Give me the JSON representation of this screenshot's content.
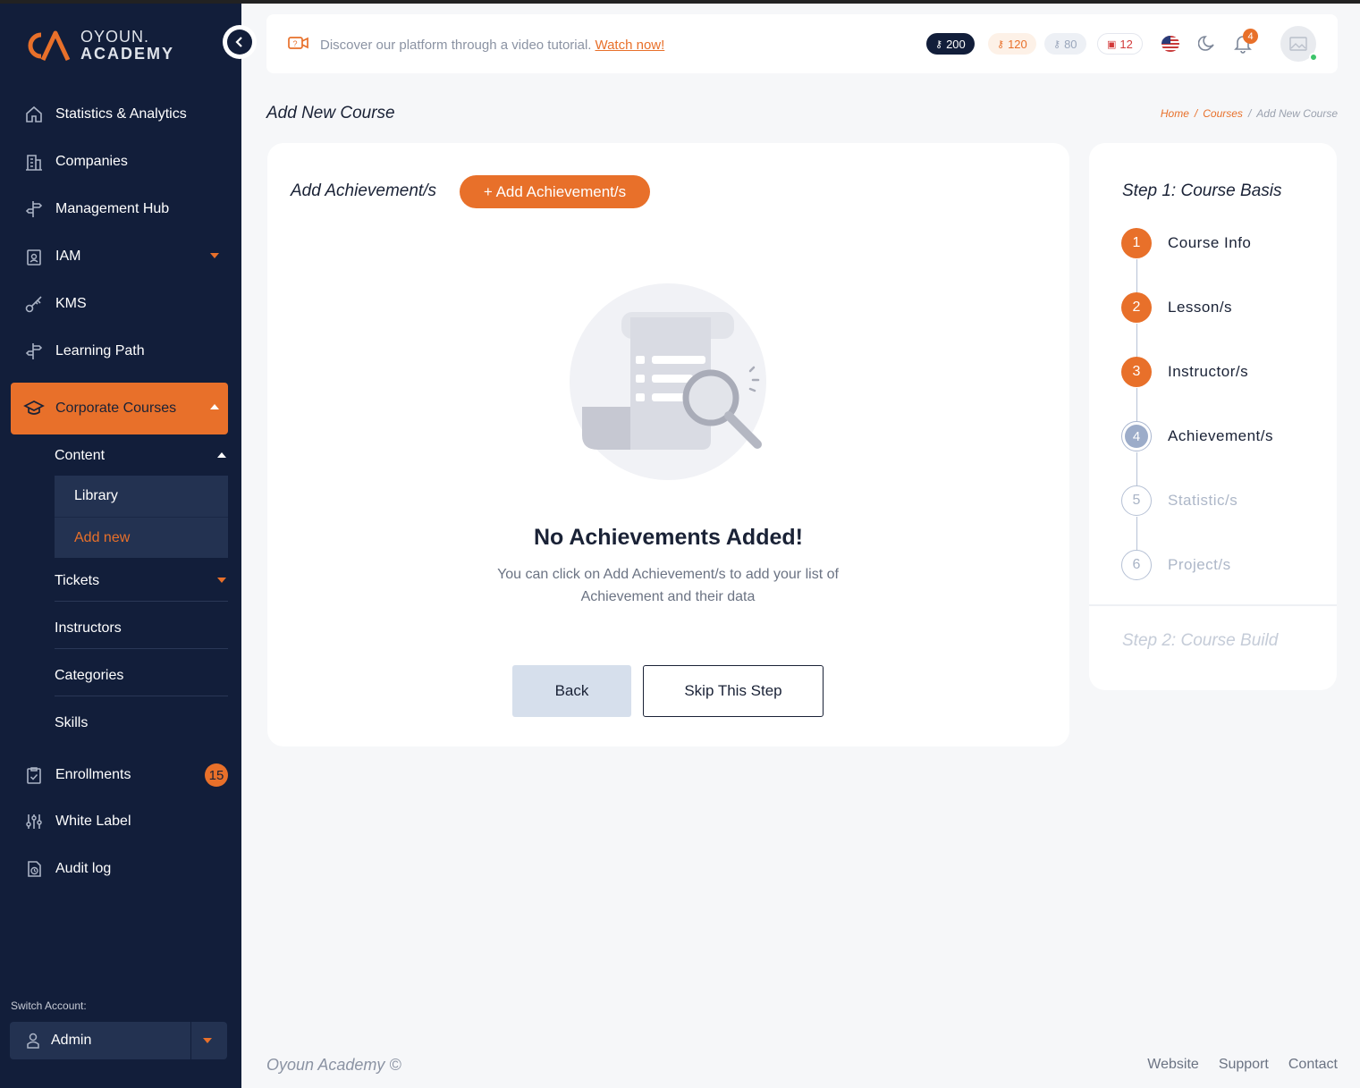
{
  "brand": {
    "line1": "OYOUN.",
    "line2": "ACADEMY"
  },
  "sidebar": {
    "items": [
      {
        "label": "Statistics & Analytics"
      },
      {
        "label": "Companies"
      },
      {
        "label": "Management Hub"
      },
      {
        "label": "IAM"
      },
      {
        "label": "KMS"
      },
      {
        "label": "Learning Path"
      },
      {
        "label": "Corporate Courses"
      },
      {
        "label": "Enrollments",
        "badge": "15"
      },
      {
        "label": "White Label"
      },
      {
        "label": "Audit log"
      }
    ],
    "sub": {
      "content": "Content",
      "library": "Library",
      "add_new": "Add new",
      "tickets": "Tickets",
      "instructors": "Instructors",
      "categories": "Categories",
      "skills": "Skills"
    },
    "switch_label": "Switch Account:",
    "switch_value": "Admin"
  },
  "header": {
    "promo_text": "Discover our platform through a video tutorial.",
    "promo_link": "Watch now!",
    "pills": [
      "200",
      "120",
      "80",
      "12"
    ],
    "notif_count": "4"
  },
  "page": {
    "title": "Add New Course",
    "breadcrumb": [
      "Home",
      "/",
      "Courses",
      "/",
      "Add New Course"
    ]
  },
  "main": {
    "section_title": "Add Achievement/s",
    "add_button": "+ Add Achievement/s",
    "empty_title": "No Achievements Added!",
    "empty_desc": "You can click on Add Achievement/s to add your list of Achievement and their data",
    "back": "Back",
    "skip": "Skip This Step"
  },
  "steps": {
    "heading": "Step 1:  Course Basis",
    "items": [
      {
        "num": "1",
        "label": "Course Info",
        "state": "done"
      },
      {
        "num": "2",
        "label": "Lesson/s",
        "state": "done"
      },
      {
        "num": "3",
        "label": "Instructor/s",
        "state": "done"
      },
      {
        "num": "4",
        "label": "Achievement/s",
        "state": "current"
      },
      {
        "num": "5",
        "label": "Statistic/s",
        "state": "todo"
      },
      {
        "num": "6",
        "label": "Project/s",
        "state": "todo"
      }
    ],
    "step2": "Step 2:  Course Build"
  },
  "footer": {
    "copyright": "Oyoun Academy ©",
    "links": [
      "Website",
      "Support",
      "Contact"
    ]
  },
  "colors": {
    "accent": "#e8702a",
    "sidebar": "#121e3a"
  }
}
